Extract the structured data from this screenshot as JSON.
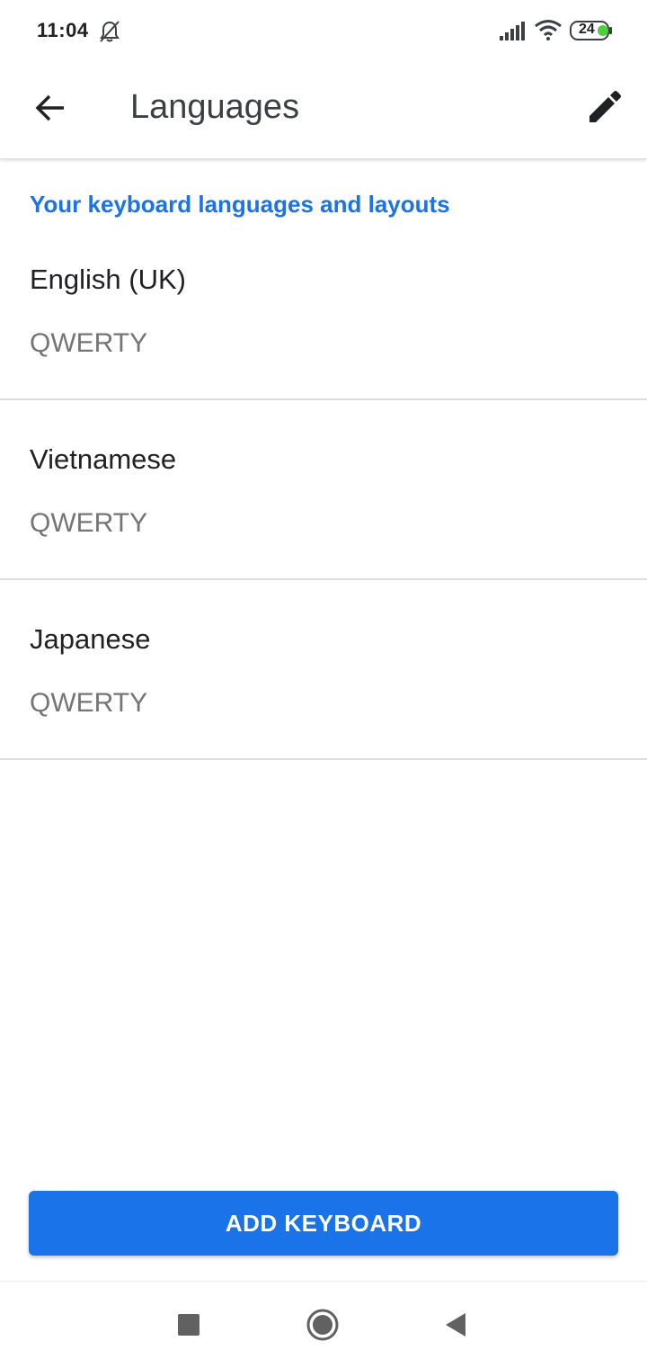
{
  "status_bar": {
    "time": "11:04",
    "battery_level": "24",
    "icons": [
      "mute-bell-icon",
      "signal-icon",
      "wifi-icon",
      "battery-icon"
    ]
  },
  "app_bar": {
    "title": "Languages",
    "back_icon": "arrow-back-icon",
    "edit_icon": "pencil-icon"
  },
  "section": {
    "header": "Your keyboard languages and layouts"
  },
  "languages": [
    {
      "name": "English (UK)",
      "layout": "QWERTY"
    },
    {
      "name": "Vietnamese",
      "layout": "QWERTY"
    },
    {
      "name": "Japanese",
      "layout": "QWERTY"
    }
  ],
  "actions": {
    "add_keyboard_label": "ADD KEYBOARD"
  },
  "nav_bar": {
    "icons": [
      "recents-square-icon",
      "home-circle-icon",
      "back-triangle-icon"
    ]
  },
  "colors": {
    "accent": "#1a73e8",
    "text_primary": "#202124",
    "text_secondary": "#757575",
    "divider": "#dadce0",
    "battery_fill": "#4cd137"
  }
}
